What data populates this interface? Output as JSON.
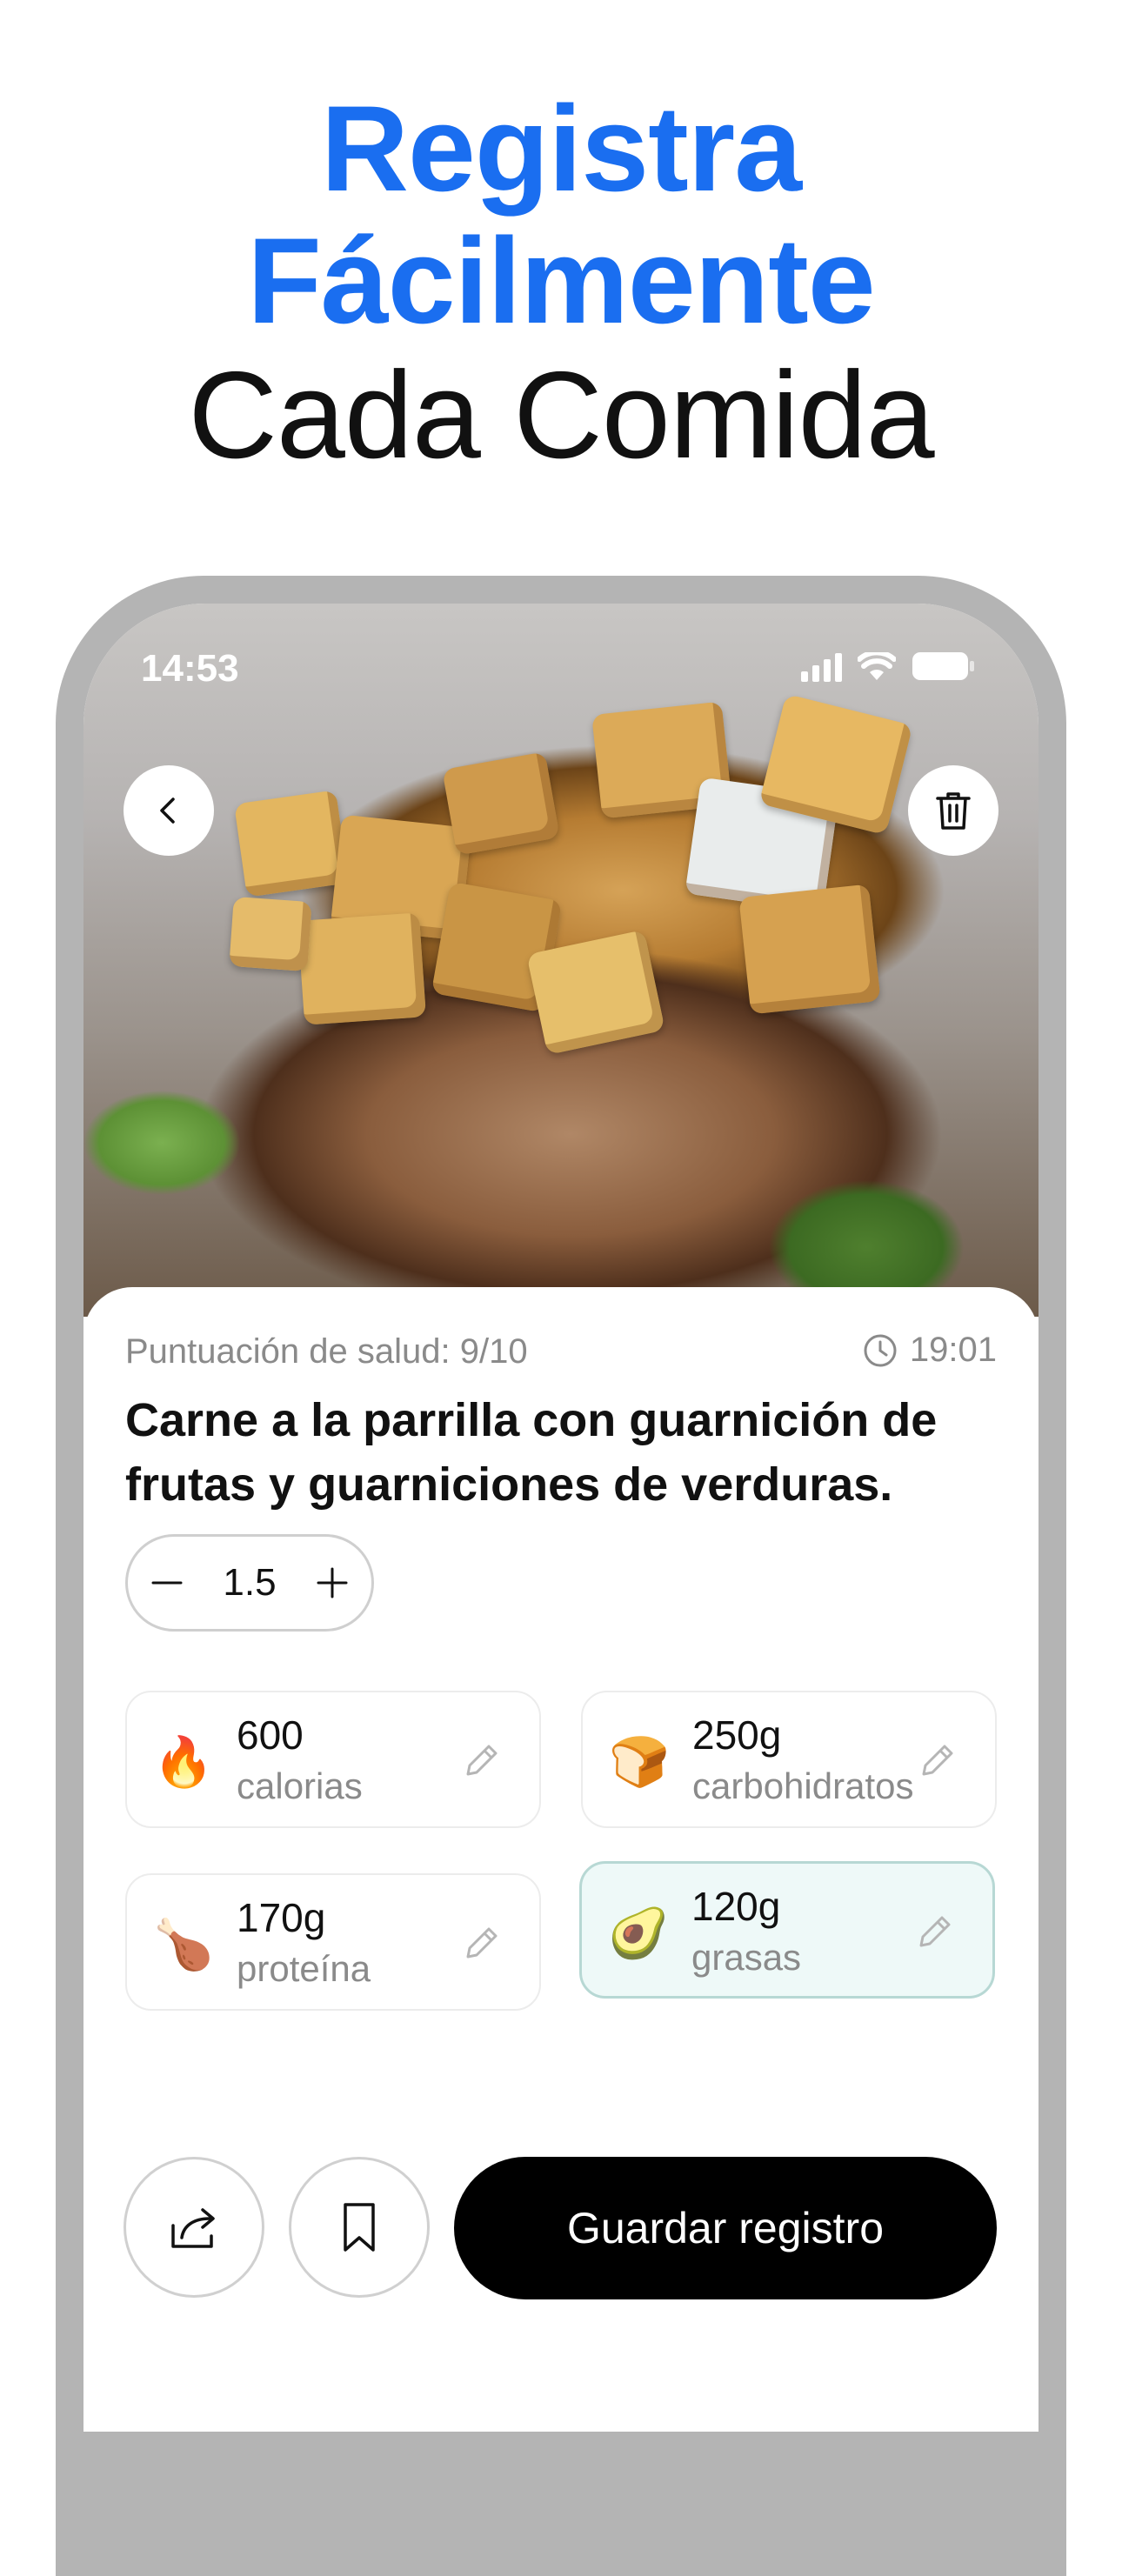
{
  "headline": {
    "line1": "Registra",
    "line2": "Fácilmente",
    "line3": "Cada Comida"
  },
  "status_bar": {
    "time": "14:53"
  },
  "meal": {
    "health_score": "Puntuación de salud: 9/10",
    "time_logged": "19:01",
    "title": "Carne a la parrilla con guarnición de frutas y guarniciones de verduras.",
    "servings": "1.5"
  },
  "nutrients": [
    {
      "amount": "600",
      "label": "calorias",
      "icon": "fire-emoji",
      "emoji": "🔥"
    },
    {
      "amount": "250g",
      "label": "carbohidratos",
      "icon": "bread-emoji",
      "emoji": "🍞"
    },
    {
      "amount": "170g",
      "label": "proteína",
      "icon": "drumstick-emoji",
      "emoji": "🍗"
    },
    {
      "amount": "120g",
      "label": "grasas",
      "icon": "avocado-emoji",
      "emoji": "🥑"
    }
  ],
  "actions": {
    "save_label": "Guardar registro"
  },
  "colors": {
    "accent_blue": "#1a6ef0",
    "highlight_tile_bg": "#eef9f8",
    "primary_button": "#000000"
  }
}
